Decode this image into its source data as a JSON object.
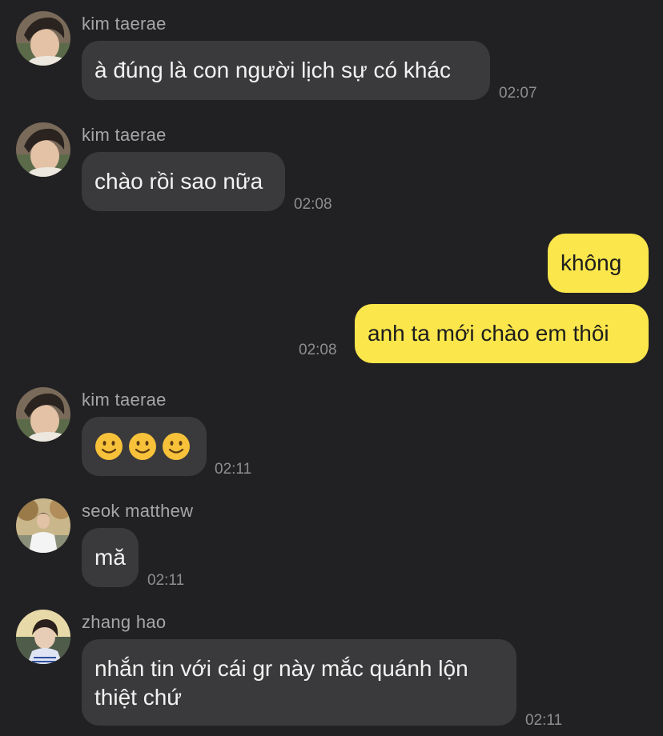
{
  "messages": [
    {
      "sender": "kim taerae",
      "text": "à đúng là con người lịch sự có khác",
      "time": "02:07"
    },
    {
      "sender": "kim taerae",
      "text": "chào rồi sao nữa",
      "time": "02:08"
    },
    {
      "text": "không"
    },
    {
      "text": "anh ta mới chào em thôi",
      "time": "02:08"
    },
    {
      "sender": "kim taerae",
      "emoji": [
        "slightly-smiling-face",
        "slightly-smiling-face",
        "slightly-smiling-face"
      ],
      "time": "02:11"
    },
    {
      "sender": "seok matthew",
      "text": "mă",
      "time": "02:11"
    },
    {
      "sender": "zhang hao",
      "text": "nhắn tin với cái gr này mắc quánh lộn thiệt chứ",
      "time": "02:11"
    }
  ],
  "colors": {
    "background": "#212123",
    "incoming_bubble": "#3a3a3c",
    "outgoing_bubble": "#fbe64b",
    "sender_name": "#a6a6a8",
    "timestamp": "#8e8e90"
  }
}
